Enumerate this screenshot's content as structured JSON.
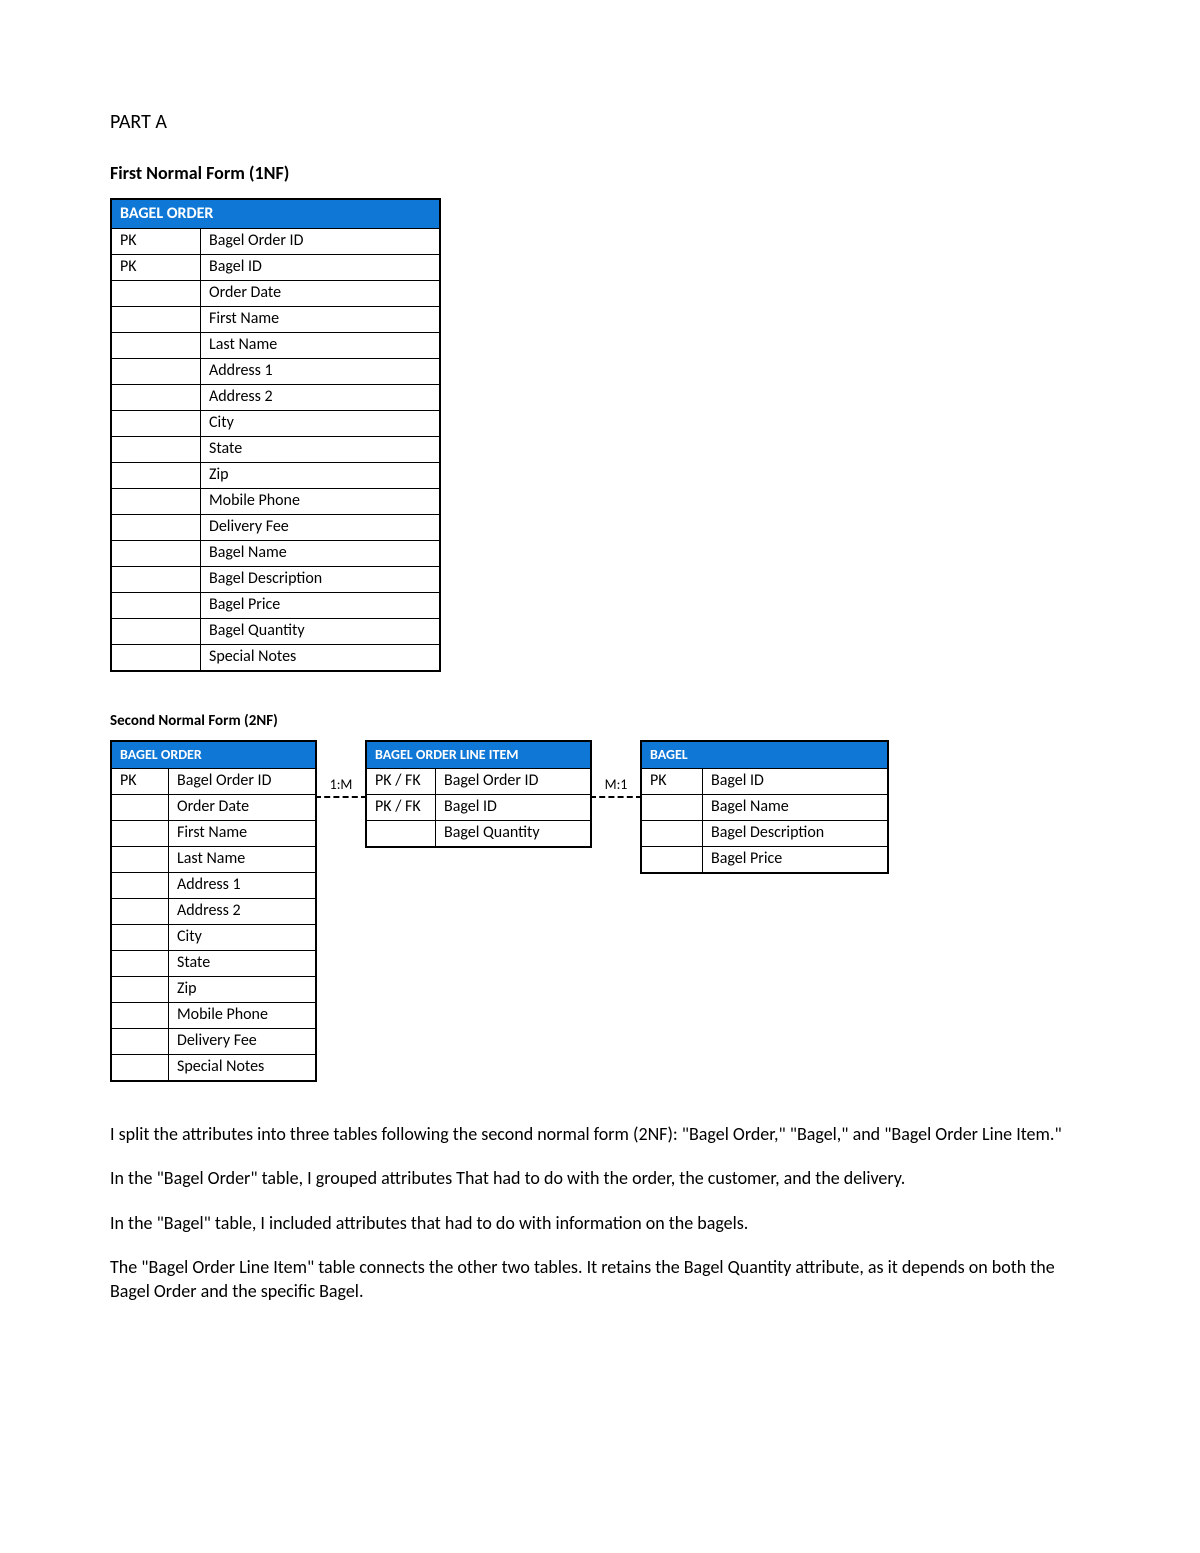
{
  "headings": {
    "part": "PART A",
    "nf1_title": "First Normal Form (1NF)",
    "nf2_title": "Second Normal Form (2NF)"
  },
  "nf1": {
    "table_name": "BAGEL ORDER",
    "rows": [
      {
        "key": "PK",
        "attr": "Bagel Order ID"
      },
      {
        "key": "PK",
        "attr": "Bagel ID"
      },
      {
        "key": "",
        "attr": "Order Date"
      },
      {
        "key": "",
        "attr": "First Name"
      },
      {
        "key": "",
        "attr": "Last Name"
      },
      {
        "key": "",
        "attr": "Address 1"
      },
      {
        "key": "",
        "attr": "Address 2"
      },
      {
        "key": "",
        "attr": "City"
      },
      {
        "key": "",
        "attr": "State"
      },
      {
        "key": "",
        "attr": "Zip"
      },
      {
        "key": "",
        "attr": "Mobile Phone"
      },
      {
        "key": "",
        "attr": "Delivery Fee"
      },
      {
        "key": "",
        "attr": "Bagel Name"
      },
      {
        "key": "",
        "attr": "Bagel Description"
      },
      {
        "key": "",
        "attr": "Bagel Price"
      },
      {
        "key": "",
        "attr": "Bagel Quantity"
      },
      {
        "key": "",
        "attr": "Special Notes"
      }
    ]
  },
  "nf2": {
    "tables": {
      "order": {
        "name": "BAGEL ORDER",
        "rows": [
          {
            "key": "PK",
            "attr": "Bagel Order ID"
          },
          {
            "key": "",
            "attr": "Order Date"
          },
          {
            "key": "",
            "attr": "First Name"
          },
          {
            "key": "",
            "attr": "Last Name"
          },
          {
            "key": "",
            "attr": "Address 1"
          },
          {
            "key": "",
            "attr": "Address 2"
          },
          {
            "key": "",
            "attr": "City"
          },
          {
            "key": "",
            "attr": "State"
          },
          {
            "key": "",
            "attr": "Zip"
          },
          {
            "key": "",
            "attr": "Mobile Phone"
          },
          {
            "key": "",
            "attr": "Delivery Fee"
          },
          {
            "key": "",
            "attr": "Special Notes"
          }
        ]
      },
      "line_item": {
        "name": "BAGEL ORDER LINE ITEM",
        "rows": [
          {
            "key": "PK / FK",
            "attr": "Bagel Order ID"
          },
          {
            "key": "PK / FK",
            "attr": "Bagel ID"
          },
          {
            "key": "",
            "attr": "Bagel Quantity"
          }
        ]
      },
      "bagel": {
        "name": "BAGEL",
        "rows": [
          {
            "key": "PK",
            "attr": "Bagel ID"
          },
          {
            "key": "",
            "attr": "Bagel Name"
          },
          {
            "key": "",
            "attr": "Bagel Description"
          },
          {
            "key": "",
            "attr": "Bagel Price"
          }
        ]
      }
    },
    "rel1": "1:M",
    "rel2": "M:1"
  },
  "paragraphs": {
    "p1": "I split the attributes into three tables following the second normal form (2NF): \"Bagel Order,\" \"Bagel,\" and \"Bagel Order Line Item.\"",
    "p2": "In the \"Bagel Order\" table, I grouped attributes That had to do with the order, the customer, and the delivery.",
    "p3": "In the \"Bagel\" table, I included attributes that had to do with information on the bagels.",
    "p4": "The \"Bagel Order Line Item\" table connects the other two tables. It retains the Bagel Quantity attribute, as it depends on both the Bagel Order and the specific Bagel."
  }
}
